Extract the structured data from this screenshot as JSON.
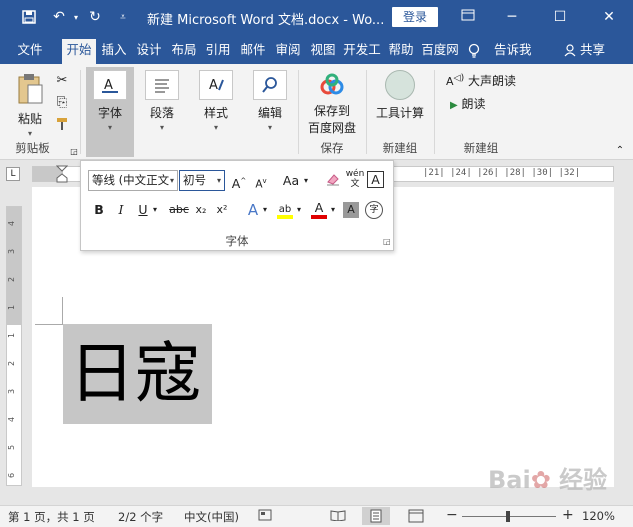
{
  "titlebar": {
    "save_icon": "save-icon",
    "undo_icon": "undo-icon",
    "redo_icon": "redo-icon",
    "customize_icon": "customize-icon",
    "title": "新建 Microsoft Word 文档.docx  -  Wo...",
    "login": "登录",
    "ribbon_display_icon": "ribbon-display-icon",
    "minimize": "─",
    "maximize": "☐",
    "close": "✕"
  },
  "tabs": [
    "文件",
    "开始",
    "插入",
    "设计",
    "布局",
    "引用",
    "邮件",
    "审阅",
    "视图",
    "开发工",
    "帮助",
    "百度网"
  ],
  "tell_me": "告诉我",
  "share": "共享",
  "ribbon": {
    "paste": "粘贴",
    "clipboard": "剪贴板",
    "font": "字体",
    "paragraph": "段落",
    "styles": "样式",
    "editing": "编辑",
    "save_to_baidu_line1": "保存到",
    "save_to_baidu_line2": "百度网盘",
    "save_group": "保存",
    "tool_calc": "工具计算",
    "new_group_1": "新建组",
    "read_aloud": "大声朗读",
    "read": "朗读",
    "new_group_2": "新建组"
  },
  "ruler": {
    "ticks": "|21|  |24|  |26|  |28|  |30|  |32|",
    "tab_selector": "L",
    "vertical_numbers": [
      "4",
      "3",
      "2",
      "1",
      "1",
      "2",
      "3",
      "4",
      "5",
      "6"
    ]
  },
  "font_panel": {
    "font_name": "等线 (中文正文",
    "font_size": "初号",
    "grow": "A",
    "shrink": "A",
    "change_case": "Aa",
    "bold": "B",
    "italic": "I",
    "underline": "U",
    "strike": "abc",
    "subscript": "x₂",
    "superscript": "x²",
    "text_effect": "A",
    "highlight": "ab",
    "font_color": "A",
    "char_shading": "A",
    "enclose": "字",
    "title": "字体",
    "highlight_color": "#ffff00",
    "font_color_value": "#e00000"
  },
  "document": {
    "text": "日寇"
  },
  "status": {
    "page": "第 1 页，共 1 页",
    "words": "2/2 个字",
    "language": "中文(中国)",
    "zoom": "120%",
    "zoom_minus": "−",
    "zoom_plus": "+"
  },
  "watermark": "Bai 经验"
}
